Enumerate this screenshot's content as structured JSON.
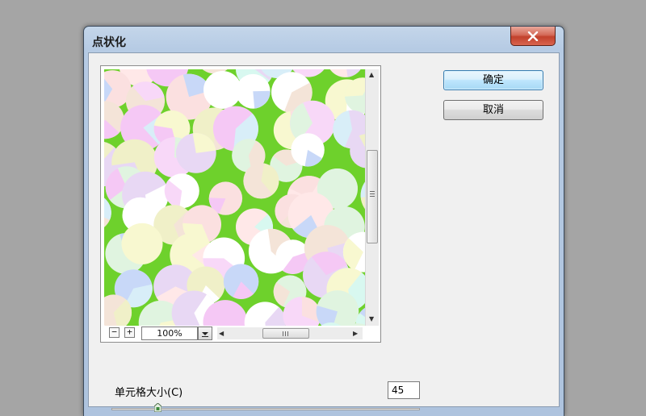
{
  "dialog": {
    "title": "点状化",
    "close_label": "✕"
  },
  "buttons": {
    "ok_label": "确定",
    "cancel_label": "取消"
  },
  "preview": {
    "zoom_out_label": "−",
    "zoom_in_label": "+",
    "zoom_level": "100%",
    "background_color": "#6ed12c",
    "cell_colors": [
      "#f5c8f5",
      "#ffffff",
      "#e8d8f4",
      "#f8f8d0",
      "#d8f8f0",
      "#fbe0e0",
      "#f0f0c8",
      "#f8d8f8",
      "#c8d8f8",
      "#ffe8e8",
      "#e0f4e0",
      "#ffffff",
      "#f4e4d8",
      "#d8eef8"
    ]
  },
  "param": {
    "label": "单元格大小(C)",
    "value": "45",
    "slider_fraction": 0.15
  },
  "icons": {
    "close": "close-icon",
    "zoom_out": "minus-icon",
    "zoom_in": "plus-icon",
    "dropdown": "chevron-down-icon",
    "scroll_up": "arrow-up-icon",
    "scroll_down": "arrow-down-icon",
    "scroll_left": "arrow-left-icon",
    "scroll_right": "arrow-right-icon"
  }
}
